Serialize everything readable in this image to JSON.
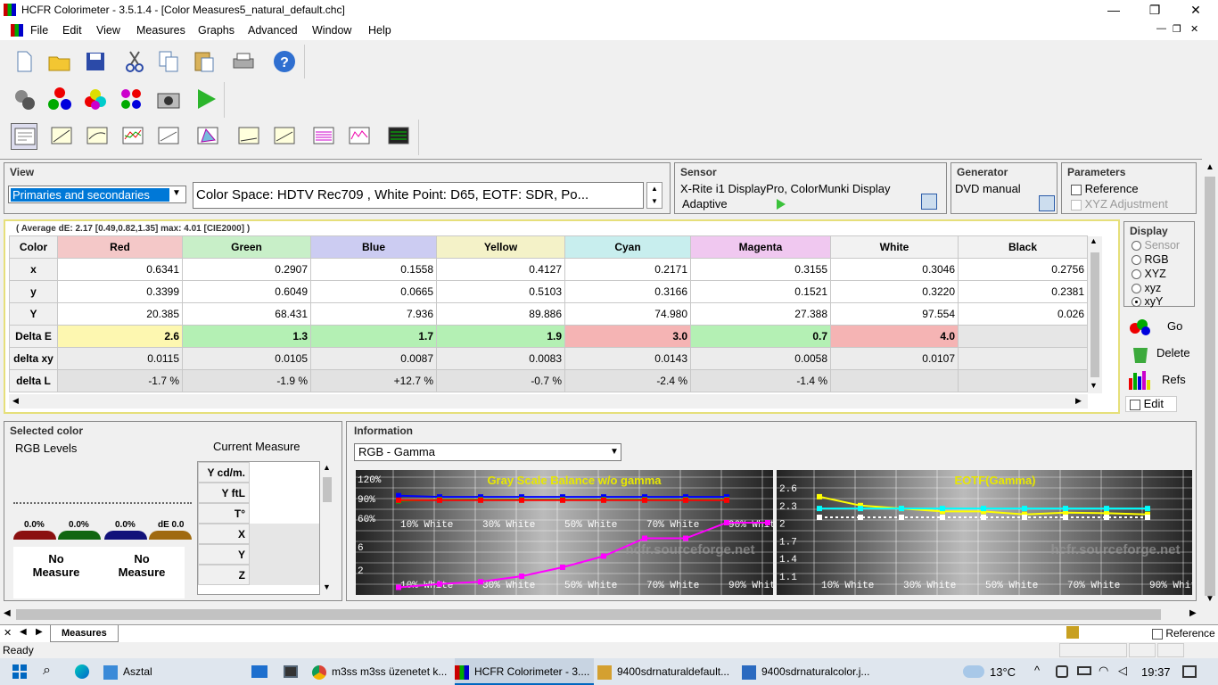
{
  "window": {
    "title": "HCFR Colorimeter - 3.5.1.4 - [Color Measures5_natural_default.chc]",
    "min": "—",
    "max": "❐",
    "close": "✕"
  },
  "menu": [
    "File",
    "Edit",
    "View",
    "Measures",
    "Graphs",
    "Advanced",
    "Window",
    "Help"
  ],
  "view": {
    "label": "View",
    "mode": "Primaries and secondaries",
    "colorspace": "Color Space: HDTV Rec709 , White Point: D65, EOTF:  SDR, Po..."
  },
  "sensor": {
    "label": "Sensor",
    "name": "X-Rite i1 DisplayPro, ColorMunki Display",
    "mode": "Adaptive"
  },
  "generator": {
    "label": "Generator",
    "name": "DVD manual"
  },
  "parameters": {
    "label": "Parameters",
    "reference": "Reference",
    "xyz_adjust": "XYZ Adjustment"
  },
  "display": {
    "label": "Display",
    "options": [
      "Sensor",
      "RGB",
      "XYZ",
      "xyz",
      "xyY"
    ],
    "selected": "xyY",
    "go": "Go",
    "delete": "Delete",
    "refs": "Refs",
    "edit": "Edit"
  },
  "summary": "( Average dE: 2.17 [0.49,0.82,1.35] max: 4.01 [CIE2000] )",
  "table": {
    "columns": [
      "Color",
      "Red",
      "Green",
      "Blue",
      "Yellow",
      "Cyan",
      "Magenta",
      "White",
      "Black"
    ],
    "rows": [
      {
        "label": "x",
        "cells": [
          "0.6341",
          "0.2907",
          "0.1558",
          "0.4127",
          "0.2171",
          "0.3155",
          "0.3046",
          "0.2756"
        ]
      },
      {
        "label": "y",
        "cells": [
          "0.3399",
          "0.6049",
          "0.0665",
          "0.5103",
          "0.3166",
          "0.1521",
          "0.3220",
          "0.2381"
        ]
      },
      {
        "label": "Y",
        "cells": [
          "20.385",
          "68.431",
          "7.936",
          "89.886",
          "74.980",
          "27.388",
          "97.554",
          "0.026"
        ]
      },
      {
        "label": "Delta E",
        "cells": [
          "2.6",
          "1.3",
          "1.7",
          "1.9",
          "3.0",
          "0.7",
          "4.0",
          ""
        ]
      },
      {
        "label": "delta xy",
        "cells": [
          "0.0115",
          "0.0105",
          "0.0087",
          "0.0083",
          "0.0143",
          "0.0058",
          "0.0107",
          ""
        ]
      },
      {
        "label": "delta L",
        "cells": [
          "-1.7 %",
          "-1.9 %",
          "+12.7 %",
          "-0.7 %",
          "-2.4 %",
          "-1.4 %",
          "",
          ""
        ]
      }
    ]
  },
  "selected": {
    "label": "Selected color",
    "rgb_levels": "RGB Levels",
    "current": "Current Measure",
    "levels": [
      "0.0%",
      "0.0%",
      "0.0%",
      "dE 0.0"
    ],
    "no1": "No",
    "measure1": "Measure",
    "no2": "No",
    "measure2": "Measure",
    "rows": [
      "Y cd/m.",
      "Y ftL",
      "T°",
      "X",
      "Y",
      "Z"
    ]
  },
  "information": {
    "label": "Information",
    "select": "RGB - Gamma"
  },
  "chart_data": [
    {
      "type": "line",
      "title": "Gray Scale Balance w/o gamma",
      "tick_labels_y": [
        "120%",
        "90%",
        "60%"
      ],
      "tick_labels_x": [
        "10% White",
        "30% White",
        "50% White",
        "70% White",
        "90% White"
      ],
      "watermark": "hcfr.sourceforge.net",
      "series": [
        {
          "color": "#0000ff",
          "values": [
            100,
            98,
            98,
            98,
            98,
            98,
            98,
            98,
            98
          ]
        },
        {
          "color": "#00cc00",
          "values": [
            92,
            94,
            94,
            94,
            94,
            94,
            94,
            94,
            94
          ]
        },
        {
          "color": "#ff0000",
          "values": [
            93,
            93,
            93,
            93,
            93,
            93,
            93,
            93,
            93
          ]
        }
      ],
      "lower_tick_labels_y": [
        "6",
        "2"
      ],
      "lower_series": {
        "color": "#ff00ff",
        "values": [
          0.2,
          0.5,
          0.7,
          1.2,
          2,
          3,
          4.6,
          4.6,
          6,
          6
        ]
      }
    },
    {
      "type": "line",
      "title": "EOTF(Gamma)",
      "tick_labels_y": [
        "2.6",
        "2.3",
        "2",
        "1.7",
        "1.4",
        "1.1"
      ],
      "tick_labels_x": [
        "10% White",
        "30% White",
        "50% White",
        "70% White",
        "90% White"
      ],
      "watermark": "hcfr.sourceforge.net",
      "series": [
        {
          "color": "#ffff00",
          "values": [
            2.45,
            2.3,
            2.25,
            2.2,
            2.2,
            2.15,
            2.18,
            2.17,
            2.15
          ]
        },
        {
          "color": "#00ffff",
          "values": [
            2.25,
            2.25,
            2.25,
            2.25,
            2.25,
            2.25,
            2.25,
            2.25,
            2.25
          ]
        },
        {
          "color": "#ffffff",
          "values": [
            2.1,
            2.1,
            2.1,
            2.1,
            2.1,
            2.1,
            2.1,
            2.1,
            2.1
          ]
        }
      ]
    }
  ],
  "tabs": {
    "measures": "Measures",
    "reference": "Reference"
  },
  "status": "Ready",
  "taskbar": {
    "items": [
      "Asztal",
      "m3ss m3ss üzenetet k...",
      "HCFR Colorimeter - 3....",
      "9400sdrnaturaldefault...",
      "9400sdrnaturalcolor.j..."
    ],
    "temp": "13°C",
    "time": "19:37"
  }
}
